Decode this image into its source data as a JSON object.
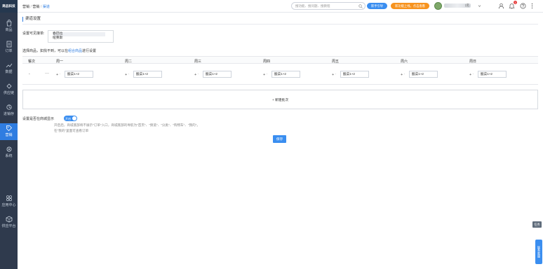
{
  "sidebar": {
    "logo": "商品科技",
    "items": [
      {
        "label": "商品",
        "icon": "bag-icon"
      },
      {
        "label": "订单",
        "icon": "document-icon"
      },
      {
        "label": "数据",
        "icon": "chart-icon"
      },
      {
        "label": "供应链",
        "icon": "link-icon"
      },
      {
        "label": "进销存",
        "icon": "cycle-icon"
      },
      {
        "label": "营销",
        "icon": "tag-icon",
        "active": true
      },
      {
        "label": "系统",
        "icon": "gear-icon"
      },
      {
        "label": "应用中心",
        "icon": "apps-icon"
      },
      {
        "label": "供应平台",
        "icon": "cube-icon"
      }
    ]
  },
  "topbar": {
    "breadcrumb": [
      "营销",
      "营销",
      "渠道"
    ],
    "search_placeholder": "搜功能、搜问题、搜教程",
    "new_guide": "新手引导",
    "promo": "新功能上线，点击查看",
    "user_suffix": "(名",
    "notif_count": "1"
  },
  "main": {
    "section_title": "渠道设置",
    "visible_label": "设置可见接单:",
    "visible_options": [
      "春巴拉",
      "纽莱斯"
    ],
    "select_hint_pre": "选择商品，如找不到，可以在",
    "select_hint_link": "组合商品",
    "select_hint_post": "进行设置",
    "columns": [
      "餐次",
      "周一",
      "周二",
      "周三",
      "周四",
      "周五",
      "周六",
      "周日"
    ],
    "row": {
      "index": "-",
      "more": "···",
      "inputs": [
        "酸菜1+2",
        "酸菜1+2",
        "酸菜1+2",
        "酸菜1+2",
        "酸菜1+2",
        "酸菜1+2",
        "酸菜1+2"
      ]
    },
    "add_batch": "+ 新建批次",
    "mall_label": "设置是否在商城显示",
    "toggle_text": "开启",
    "hint1": "开启后，商城底部将不展示\"订单\"入口，商城底部的导航为\"首页\"、\"频道\"、\"分类\"、\"购物车\"、\"我的\"。",
    "hint2": "在\"我的\"里面可查看订单",
    "save": "保存"
  },
  "float": {
    "task": "任务",
    "service": "联系客服"
  }
}
